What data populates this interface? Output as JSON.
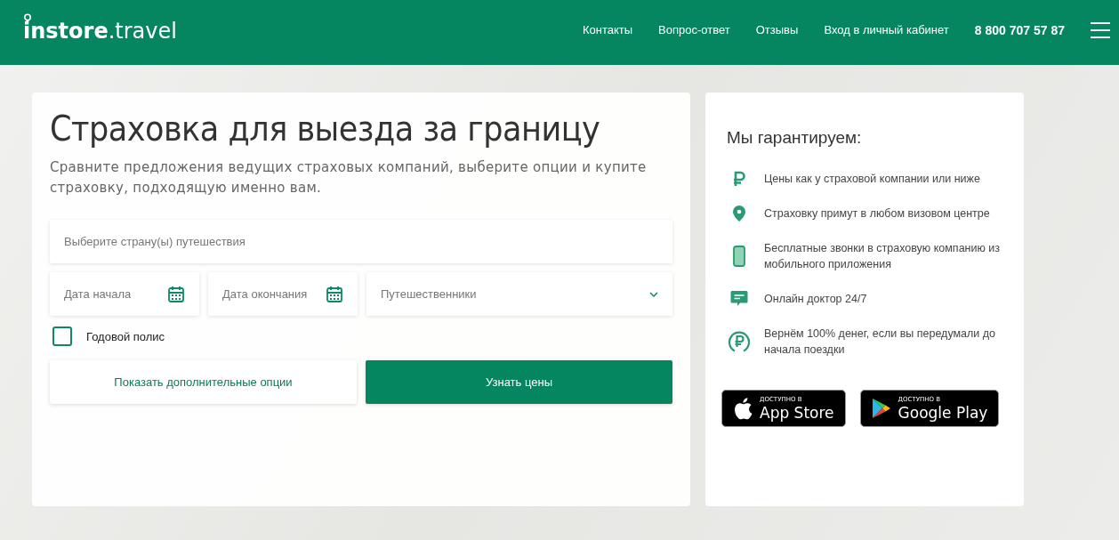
{
  "header": {
    "logo": "**instore**.travel",
    "nav": [
      "Контакты",
      "Вопрос-ответ",
      "Отзывы",
      "Вход в личный кабинет"
    ],
    "phone": "8 800 707 57 87"
  },
  "search": {
    "title": "Страховка для выезда за границу",
    "subtitle": "Сравните предложения ведущих страховых компаний, выберите опции и купите страховку, подходящую именно вам.",
    "country": {
      "placeholder": "Выберите страну(ы) путешествия"
    },
    "date_start": {
      "placeholder": "Дата начала"
    },
    "date_end": {
      "placeholder": "Дата окончания"
    },
    "travelers": {
      "placeholder": "Путешественники"
    },
    "annual": {
      "label": "Годовой полис",
      "checked": false
    },
    "options_button": "Показать дополнительные опции",
    "submit_button": "Узнать цены"
  },
  "guarantees": {
    "title": "Мы гарантируем:",
    "items": [
      {
        "kind": "ruble",
        "text": "Цены как у страховой компании или ниже"
      },
      {
        "kind": "pin",
        "text": "Страховку примут в любом визовом центре"
      },
      {
        "kind": "phone",
        "text": "Бесплатные звонки в страховую компанию из мобильного приложения"
      },
      {
        "kind": "chat",
        "text": "Онлайн доктор 24/7"
      },
      {
        "kind": "refund",
        "text": "Вернём 100% денег, если вы передумали до начала поездки"
      }
    ],
    "stores": [
      {
        "kind": "apple",
        "caption": "ДОСТУПНО В",
        "name": "App Store"
      },
      {
        "kind": "google",
        "caption": "ДОСТУПНО В",
        "name": "Google Play"
      }
    ]
  }
}
